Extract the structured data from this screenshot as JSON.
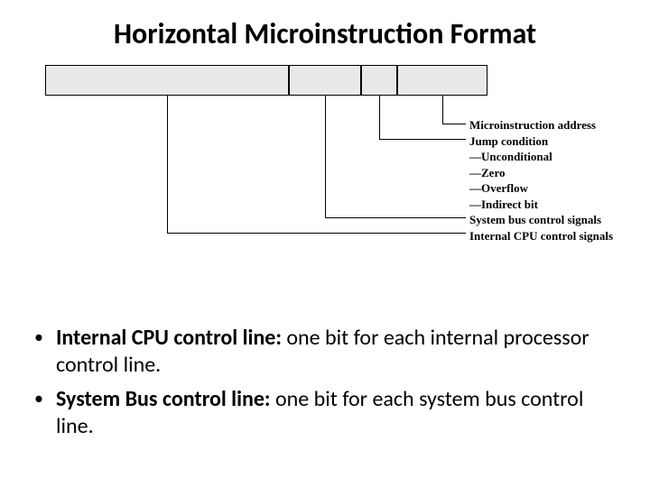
{
  "title": "Horizontal Microinstruction Format",
  "labels": {
    "l1": "Microinstruction address",
    "l2": "Jump condition",
    "l3": "—Unconditional",
    "l4": "—Zero",
    "l5": "—Overflow",
    "l6": "—Indirect bit",
    "l7": "System bus control signals",
    "l8": "Internal CPU control signals"
  },
  "bullets": {
    "b1": {
      "bold": "Internal CPU control line:",
      "rest": " one bit for each internal processor control line."
    },
    "b2": {
      "bold": " System Bus control line: ",
      "rest": "one bit for each system bus control line."
    }
  }
}
